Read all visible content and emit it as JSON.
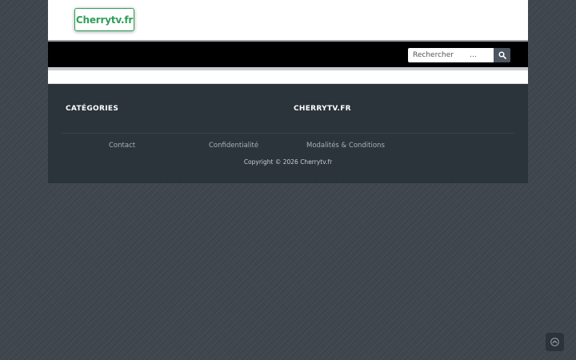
{
  "header": {
    "logo_text": "Cherrytv.fr"
  },
  "search": {
    "placeholder": "Rechercher       …",
    "button_icon": "search-icon"
  },
  "footer": {
    "widget_categories_title": "CATÉGORIES",
    "widget_site_title": "CHERRYTV.FR",
    "links": [
      {
        "label": "Contact"
      },
      {
        "label": "Confidentialité"
      },
      {
        "label": "Modalités & Conditions"
      }
    ],
    "copyright": "Copyright © 2026 Cherrytv.fr"
  },
  "scroll_top": {
    "icon": "chevron-up-icon"
  },
  "colors": {
    "brand": "#2f9e57",
    "navbar": "#000000",
    "footer": "#2b333b",
    "page_bg": "#3e454d",
    "search_button": "#4c5560"
  }
}
